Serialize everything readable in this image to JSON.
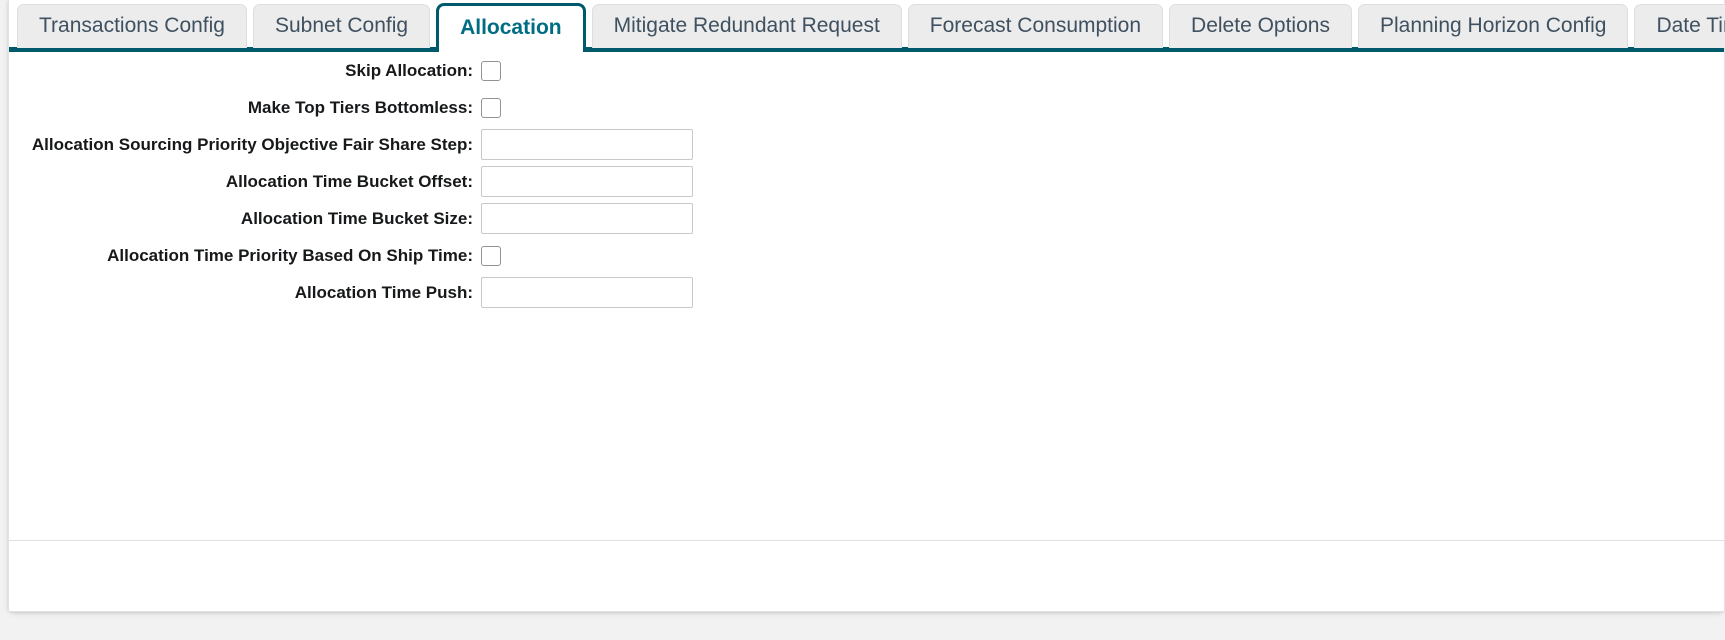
{
  "tabs": [
    {
      "label": "Transactions Config",
      "active": false
    },
    {
      "label": "Subnet Config",
      "active": false
    },
    {
      "label": "Allocation",
      "active": true
    },
    {
      "label": "Mitigate Redundant Request",
      "active": false
    },
    {
      "label": "Forecast Consumption",
      "active": false
    },
    {
      "label": "Delete Options",
      "active": false
    },
    {
      "label": "Planning Horizon Config",
      "active": false
    },
    {
      "label": "Date Time Config",
      "active": false
    }
  ],
  "colors": {
    "accent_teal": "#005a6c",
    "active_tab_text": "#006d84",
    "inactive_tab_bg": "#ececec",
    "inactive_tab_text": "#3f5160",
    "page_bg": "#f2f2f2",
    "card_bg": "#ffffff",
    "input_border": "#c9c9c9",
    "checkbox_border": "#939393",
    "label_text": "#16181a"
  },
  "form": {
    "fields": [
      {
        "label": "Skip Allocation:",
        "type": "checkbox",
        "checked": false,
        "value": "",
        "placeholder": ""
      },
      {
        "label": "Make Top Tiers Bottomless:",
        "type": "checkbox",
        "checked": false,
        "value": "",
        "placeholder": ""
      },
      {
        "label": "Allocation Sourcing Priority Objective Fair Share Step:",
        "type": "text",
        "checked": false,
        "value": "",
        "placeholder": ""
      },
      {
        "label": "Allocation Time Bucket Offset:",
        "type": "text",
        "checked": false,
        "value": "",
        "placeholder": ""
      },
      {
        "label": "Allocation Time Bucket Size:",
        "type": "text",
        "checked": false,
        "value": "",
        "placeholder": ""
      },
      {
        "label": "Allocation Time Priority Based On Ship Time:",
        "type": "checkbox",
        "checked": false,
        "value": "",
        "placeholder": ""
      },
      {
        "label": "Allocation Time Push:",
        "type": "text",
        "checked": false,
        "value": "",
        "placeholder": ""
      }
    ]
  }
}
